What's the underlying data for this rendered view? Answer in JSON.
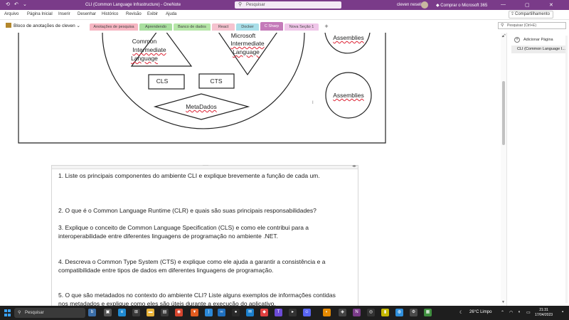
{
  "titlebar": {
    "doc_title": "CLI (Common Language Infrastructure) - OneNote",
    "search_placeholder": "Pesquisar",
    "user_name": "cleven neselio",
    "buy_label": "Comprar o Microsoft 365",
    "accent_color": "#7a3b89"
  },
  "menu": {
    "items": [
      "Arquivo",
      "Página Inicial",
      "Inserir",
      "Desenhar",
      "Histórico",
      "Revisão",
      "Exibir",
      "Ajuda"
    ],
    "share_label": "Compartilhamento"
  },
  "notebook": {
    "name": "Bloco de anotações de cleven"
  },
  "sections": [
    {
      "label": "Anotações de pesquisa",
      "color": "#f6b6c2"
    },
    {
      "label": "Aprendendo",
      "color": "#a9df9f"
    },
    {
      "label": "Banco de dados",
      "color": "#b6e6a8"
    },
    {
      "label": "React",
      "color": "#f5c3cf"
    },
    {
      "label": "Docker",
      "color": "#a8dfe9"
    },
    {
      "label": "C Sharp",
      "color": "#c47ab9",
      "active": true
    },
    {
      "label": "Nova Seção 1",
      "color": "#f0c6e9"
    }
  ],
  "right_search": {
    "placeholder": "Pesquisar (Ctrl+E)"
  },
  "diagram": {
    "triangle_label_1": "Common",
    "triangle_label_2": "Intermediate",
    "triangle_label_3": "Language",
    "inv_triangle_label_1": "Microsoft",
    "inv_triangle_label_2": "Intermediate",
    "inv_triangle_label_3": "Language",
    "cls_label": "CLS",
    "cts_label": "CTS",
    "metadata_label": "MetaDados",
    "assemblies_top": "Assemblies",
    "assemblies_bottom": "Assemblies"
  },
  "questions": [
    {
      "line1": "1. Liste os principais componentes do ambiente CLI e explique brevemente a função de cada um.",
      "line2": ""
    },
    {
      "line1": "2. O que é o Common Language Runtime (CLR) e quais são suas principais responsabilidades?",
      "line2": ""
    },
    {
      "line1": "3. Explique o conceito de Common Language Specification (CLS) e como ele contribui para a",
      "line2": "interoperabilidade entre diferentes linguagens de programação no ambiente .NET."
    },
    {
      "line1": "4. Descreva o Common Type System (CTS) e explique como ele ajuda a garantir a consistência e a",
      "line2": "compatibilidade entre tipos de dados em diferentes linguagens de programação."
    },
    {
      "line1": "5. O que são metadados no contexto do ambiente CLI? Liste alguns exemplos de informações contidas",
      "line2": "nos metadados e explique como eles são úteis durante a execução do aplicativo."
    }
  ],
  "pages_pane": {
    "add_page_label": "Adicionar Página",
    "pages": [
      "CLI (Common Language I..."
    ]
  },
  "taskbar": {
    "search_label": "Pesquisar",
    "weather": "26°C  Limpo",
    "time": "21:31",
    "date": "17/04/2023"
  }
}
